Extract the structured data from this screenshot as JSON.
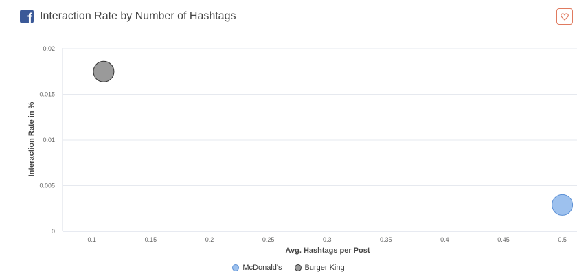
{
  "header": {
    "icon": "facebook-icon",
    "title": "Interaction Rate by Number of Hashtags",
    "favorite_icon": "heart-icon",
    "accent": "#e07a5f"
  },
  "chart_data": {
    "type": "scatter",
    "title": "Interaction Rate by Number of Hashtags",
    "xlabel": "Avg. Hashtags per Post",
    "ylabel": "Interaction Rate in %",
    "xlim": [
      0.075,
      0.5125
    ],
    "ylim": [
      0,
      0.02
    ],
    "x_ticks": [
      0.1,
      0.15,
      0.2,
      0.25,
      0.3,
      0.35,
      0.4,
      0.45,
      0.5
    ],
    "x_tick_labels": [
      "0.1",
      "0.15",
      "0.2",
      "0.25",
      "0.3",
      "0.35",
      "0.4",
      "0.45",
      "0.5"
    ],
    "y_ticks": [
      0,
      0.005,
      0.01,
      0.015,
      0.02
    ],
    "y_tick_labels": [
      "0",
      "0.005",
      "0.01",
      "0.015",
      "0.02"
    ],
    "grid": "horizontal",
    "legend_position": "bottom-center",
    "series": [
      {
        "name": "McDonald's",
        "color": "#9dc1ee",
        "stroke": "#5b8fd4",
        "points": [
          {
            "x": 0.5,
            "y": 0.0029
          }
        ]
      },
      {
        "name": "Burger King",
        "color": "#9a9a9a",
        "stroke": "#333333",
        "points": [
          {
            "x": 0.11,
            "y": 0.0175
          }
        ]
      }
    ]
  }
}
